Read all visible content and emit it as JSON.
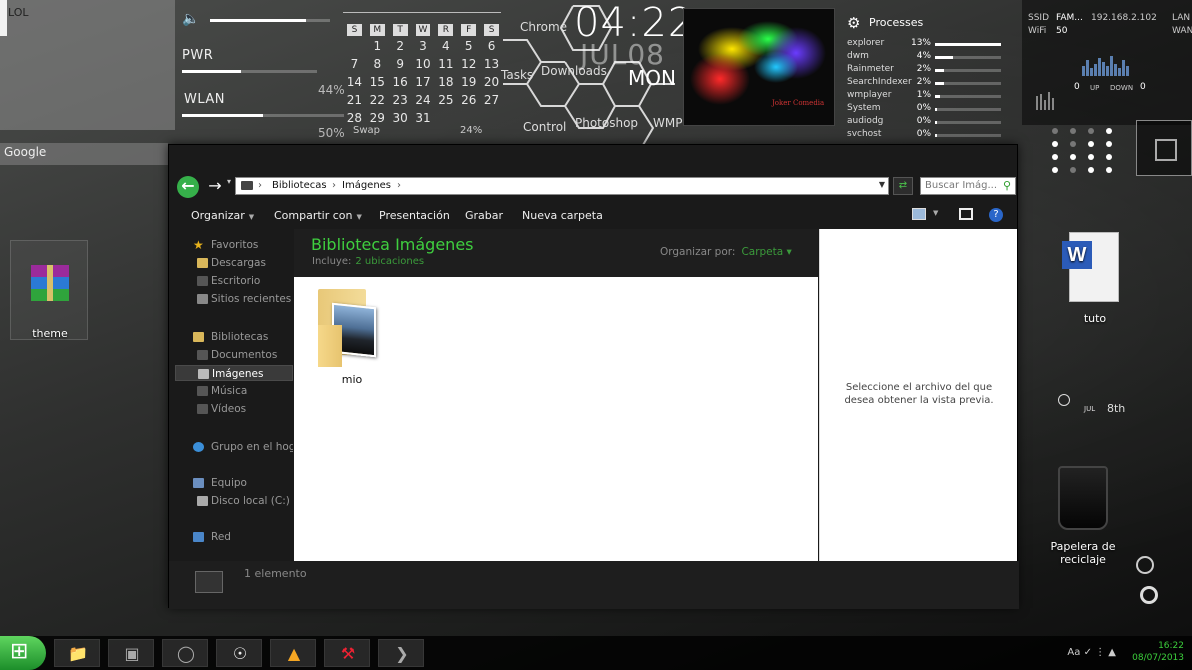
{
  "desktop": {
    "lol_label": "LOL",
    "google_label": "Google"
  },
  "meters": {
    "items": [
      {
        "label": "PWR",
        "percent": "44%",
        "fill": 0.44
      },
      {
        "label": "WLAN",
        "percent": "50%",
        "fill": 0.5
      }
    ],
    "volume_fill": 0.8,
    "swap_label": "Swap",
    "swap_percent": "24%"
  },
  "calendar": {
    "day_headers": [
      "S",
      "M",
      "T",
      "W",
      "R",
      "F",
      "S"
    ],
    "weeks": [
      [
        "",
        "1",
        "2",
        "3",
        "4",
        "5",
        "6"
      ],
      [
        "7",
        "8",
        "9",
        "10",
        "11",
        "12",
        "13"
      ],
      [
        "14",
        "15",
        "16",
        "17",
        "18",
        "19",
        "20"
      ],
      [
        "21",
        "22",
        "23",
        "24",
        "25",
        "26",
        "27"
      ],
      [
        "28",
        "29",
        "30",
        "31",
        "",
        "",
        ""
      ]
    ]
  },
  "launcher": {
    "items": [
      "Chrome",
      "Tasks",
      "Downloads",
      "Control",
      "Photoshop",
      "WMP"
    ]
  },
  "clock": {
    "time": "04:22",
    "date": "JUL08",
    "day": "MON"
  },
  "album": {
    "caption": "Joker Comedia"
  },
  "processes": {
    "title": "Processes",
    "rows": [
      {
        "name": "explorer",
        "pct": "13%",
        "fill": 1.0
      },
      {
        "name": "dwm",
        "pct": "4%",
        "fill": 0.28
      },
      {
        "name": "Rainmeter",
        "pct": "2%",
        "fill": 0.14
      },
      {
        "name": "SearchIndexer",
        "pct": "2%",
        "fill": 0.14
      },
      {
        "name": "wmplayer",
        "pct": "1%",
        "fill": 0.07
      },
      {
        "name": "System",
        "pct": "0%",
        "fill": 0.03
      },
      {
        "name": "audiodg",
        "pct": "0%",
        "fill": 0.03
      },
      {
        "name": "svchost",
        "pct": "0%",
        "fill": 0.03
      }
    ]
  },
  "network": {
    "ssid_label": "SSID",
    "ssid_value": "FAM...",
    "ip": "192.168.2.102",
    "lan_label": "LAN",
    "wifi_label": "WiFi",
    "wifi_value": "50",
    "wan_label": "WAN",
    "up_value": "0",
    "up_label": "UP",
    "down_label": "DOWN",
    "down_value": "0"
  },
  "desktop_icons": {
    "theme": "theme",
    "tuto": "tuto",
    "recycle": "Papelera de reciclaje",
    "jul_label": "JUL",
    "jul_day": "8th"
  },
  "explorer": {
    "breadcrumbs": [
      "Bibliotecas",
      "Imágenes"
    ],
    "search_placeholder": "Buscar Imág...",
    "toolbar": {
      "organize": "Organizar",
      "share": "Compartir con",
      "presentation": "Presentación",
      "burn": "Grabar",
      "new_folder": "Nueva carpeta"
    },
    "nav": {
      "favorites": "Favoritos",
      "downloads": "Descargas",
      "desktop": "Escritorio",
      "recent": "Sitios recientes",
      "libraries": "Bibliotecas",
      "documents": "Documentos",
      "images": "Imágenes",
      "music": "Música",
      "videos": "Vídeos",
      "homegroup": "Grupo en el hogar",
      "computer": "Equipo",
      "local_disk": "Disco local (C:)",
      "network": "Red"
    },
    "library": {
      "title": "Biblioteca Imágenes",
      "includes_label": "Incluye:",
      "includes_value": "2 ubicaciones",
      "arrange_label": "Organizar por:",
      "arrange_value": "Carpeta"
    },
    "items": [
      {
        "name": "mio"
      }
    ],
    "preview_message": "Seleccione el archivo del que desea obtener la vista previa.",
    "status_count": "1 elemento"
  },
  "taskbar": {
    "time": "16:22",
    "date": "08/07/2013",
    "tray_text": "Aa"
  }
}
